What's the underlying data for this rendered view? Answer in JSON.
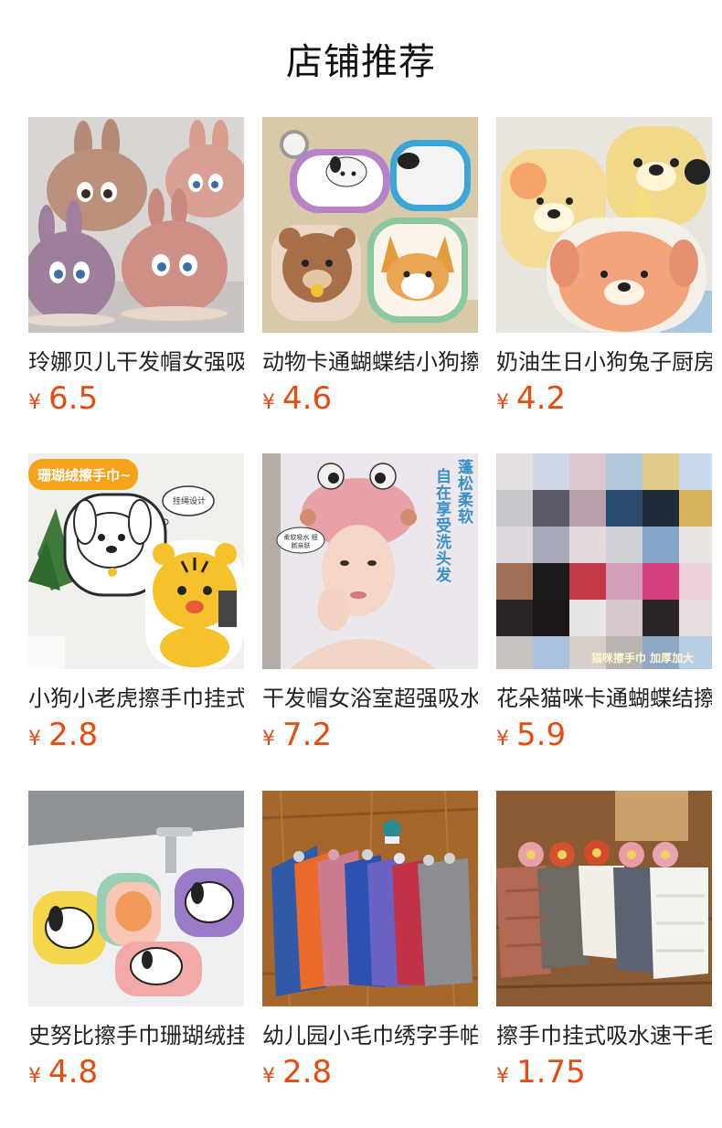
{
  "header": {
    "title": "店铺推荐"
  },
  "currency": "¥",
  "colors": {
    "price": "#e64b10"
  },
  "products": [
    {
      "title": "玲娜贝儿干发帽女强吸水速干",
      "price": "6.5",
      "image_icon": "bunny-hair-caps-image"
    },
    {
      "title": "动物卡通蝴蝶结小狗擦手巾",
      "price": "4.6",
      "image_icon": "animal-hand-towels-image"
    },
    {
      "title": "奶油生日小狗兔子厨房擦手巾",
      "price": "4.2",
      "image_icon": "cream-dog-towels-image"
    },
    {
      "title": "小狗小老虎擦手巾挂式",
      "price": "2.8",
      "image_icon": "dog-tiger-towels-image",
      "banner": "珊瑚绒擦手巾~",
      "bubble": "挂绳设计"
    },
    {
      "title": "干发帽女浴室超强吸水",
      "price": "7.2",
      "image_icon": "hair-cap-model-image",
      "vertical_1": "蓬松柔软",
      "vertical_2": "自在享受洗头发",
      "tag": "柔软吸水 细腻亲肤"
    },
    {
      "title": "花朵猫咪卡通蝴蝶结擦手巾",
      "price": "5.9",
      "image_icon": "cat-towels-image",
      "caption": "猫咪擦手巾 加厚加大"
    },
    {
      "title": "史努比擦手巾珊瑚绒挂式",
      "price": "4.8",
      "image_icon": "snoopy-towels-image"
    },
    {
      "title": "幼儿园小毛巾绣字手帕",
      "price": "2.8",
      "image_icon": "kids-towels-image"
    },
    {
      "title": "擦手巾挂式吸水速干毛巾",
      "price": "1.75",
      "image_icon": "flower-towels-image"
    }
  ]
}
